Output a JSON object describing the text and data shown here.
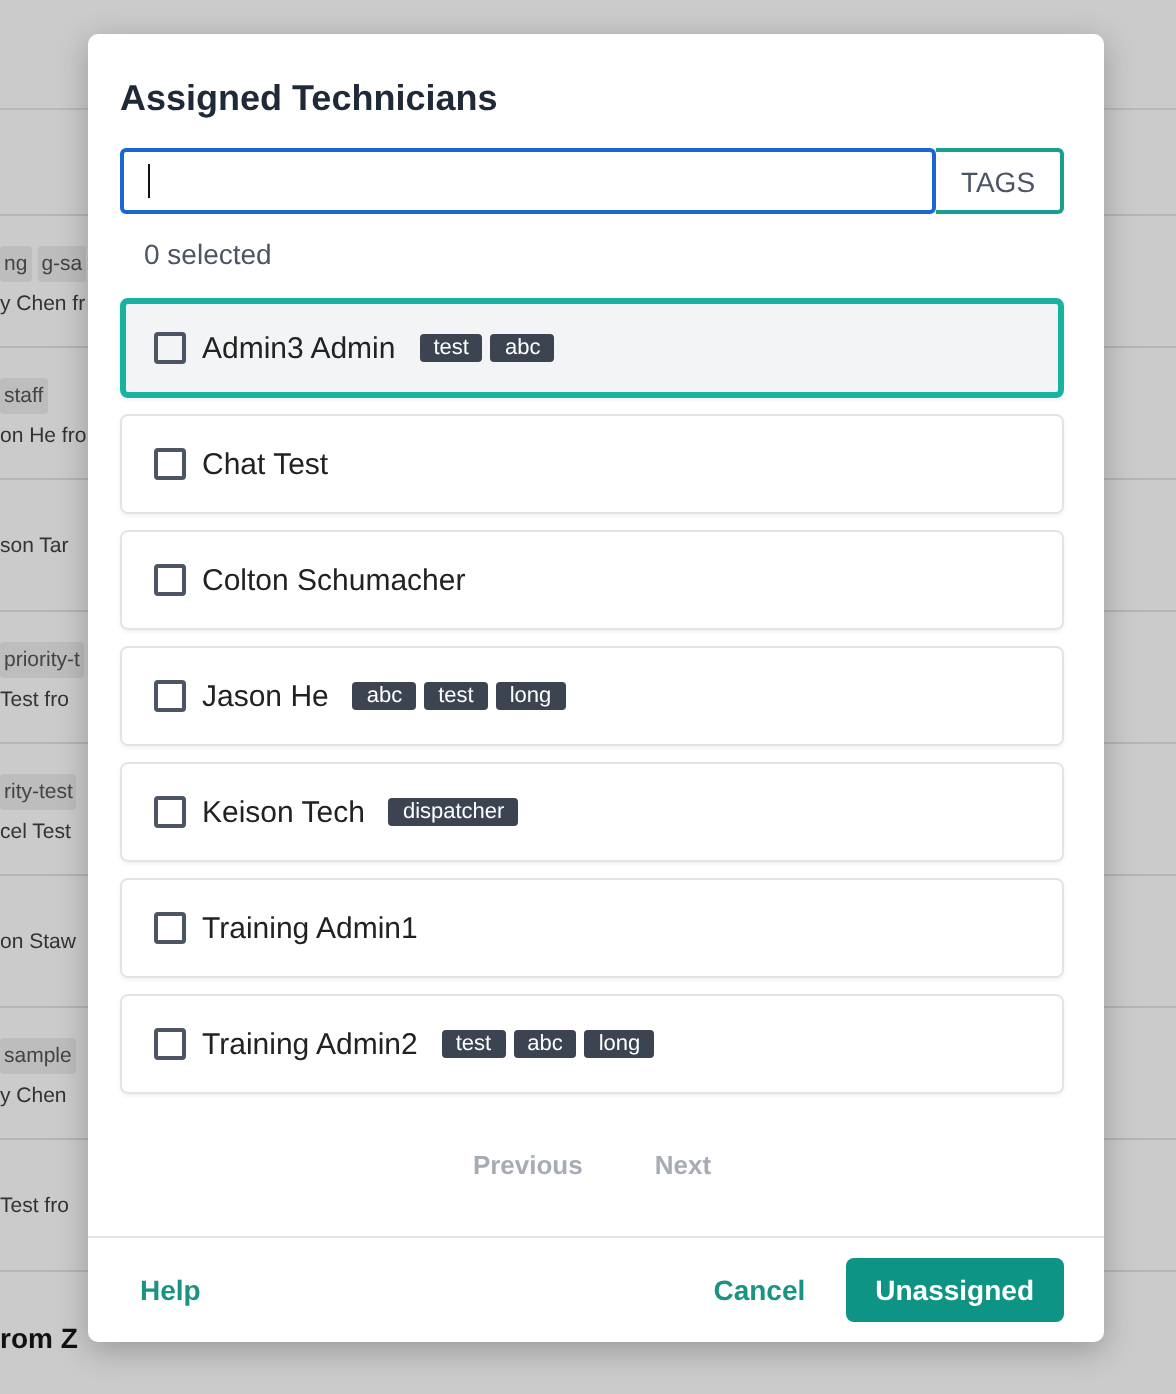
{
  "background_rows": [
    {
      "lines": [
        [
          {
            "kind": "tag",
            "text": "ng"
          },
          {
            "kind": "tag",
            "text": "g-sa"
          }
        ],
        [
          {
            "kind": "text",
            "text": "y Chen fr"
          }
        ]
      ]
    },
    {
      "lines": [
        [
          {
            "kind": "tag",
            "text": "staff"
          }
        ],
        [
          {
            "kind": "text",
            "text": "on He fro"
          }
        ]
      ]
    },
    {
      "lines": [
        [
          {
            "kind": "text",
            "text": "son Tar"
          }
        ]
      ]
    },
    {
      "lines": [
        [
          {
            "kind": "tag",
            "text": "priority-t"
          }
        ],
        [
          {
            "kind": "text",
            "text": "Test fro"
          }
        ]
      ]
    },
    {
      "lines": [
        [
          {
            "kind": "tag",
            "text": "rity-test"
          }
        ],
        [
          {
            "kind": "text",
            "text": "cel Test"
          }
        ]
      ]
    },
    {
      "lines": [
        [
          {
            "kind": "text",
            "text": "on Staw"
          }
        ]
      ]
    },
    {
      "lines": [
        [
          {
            "kind": "tag",
            "text": "sample"
          }
        ],
        [
          {
            "kind": "text",
            "text": "y Chen"
          }
        ]
      ]
    },
    {
      "lines": [
        [
          {
            "kind": "text",
            "text": "Test fro"
          }
        ]
      ]
    },
    {
      "lines": [
        [
          {
            "kind": "title",
            "text": "rom Z"
          }
        ]
      ]
    }
  ],
  "dialog": {
    "title": "Assigned Technicians",
    "search": {
      "focused": true
    },
    "tags_button": "TAGS",
    "selected_count": "0 selected",
    "technicians": [
      {
        "name": "Admin3 Admin",
        "checked": false,
        "highlighted": true,
        "tags": [
          "test",
          "abc"
        ]
      },
      {
        "name": "Chat Test",
        "checked": false,
        "highlighted": false
      },
      {
        "name": "Colton Schumacher",
        "checked": false,
        "highlighted": false
      },
      {
        "name": "Jason He",
        "checked": false,
        "highlighted": false,
        "tags": [
          "abc",
          "test",
          "long"
        ]
      },
      {
        "name": "Keison Tech",
        "checked": false,
        "highlighted": false,
        "tags": [
          "dispatcher"
        ]
      },
      {
        "name": "Training Admin1",
        "checked": false,
        "highlighted": false
      },
      {
        "name": "Training Admin2",
        "checked": false,
        "highlighted": false,
        "tags": [
          "test",
          "abc",
          "long"
        ]
      }
    ],
    "pagination": [
      {
        "label": "Previous",
        "disabled": true
      },
      {
        "label": "Next",
        "disabled": true
      }
    ],
    "help": "Help",
    "cancel": "Cancel",
    "confirm": "Unassigned"
  }
}
